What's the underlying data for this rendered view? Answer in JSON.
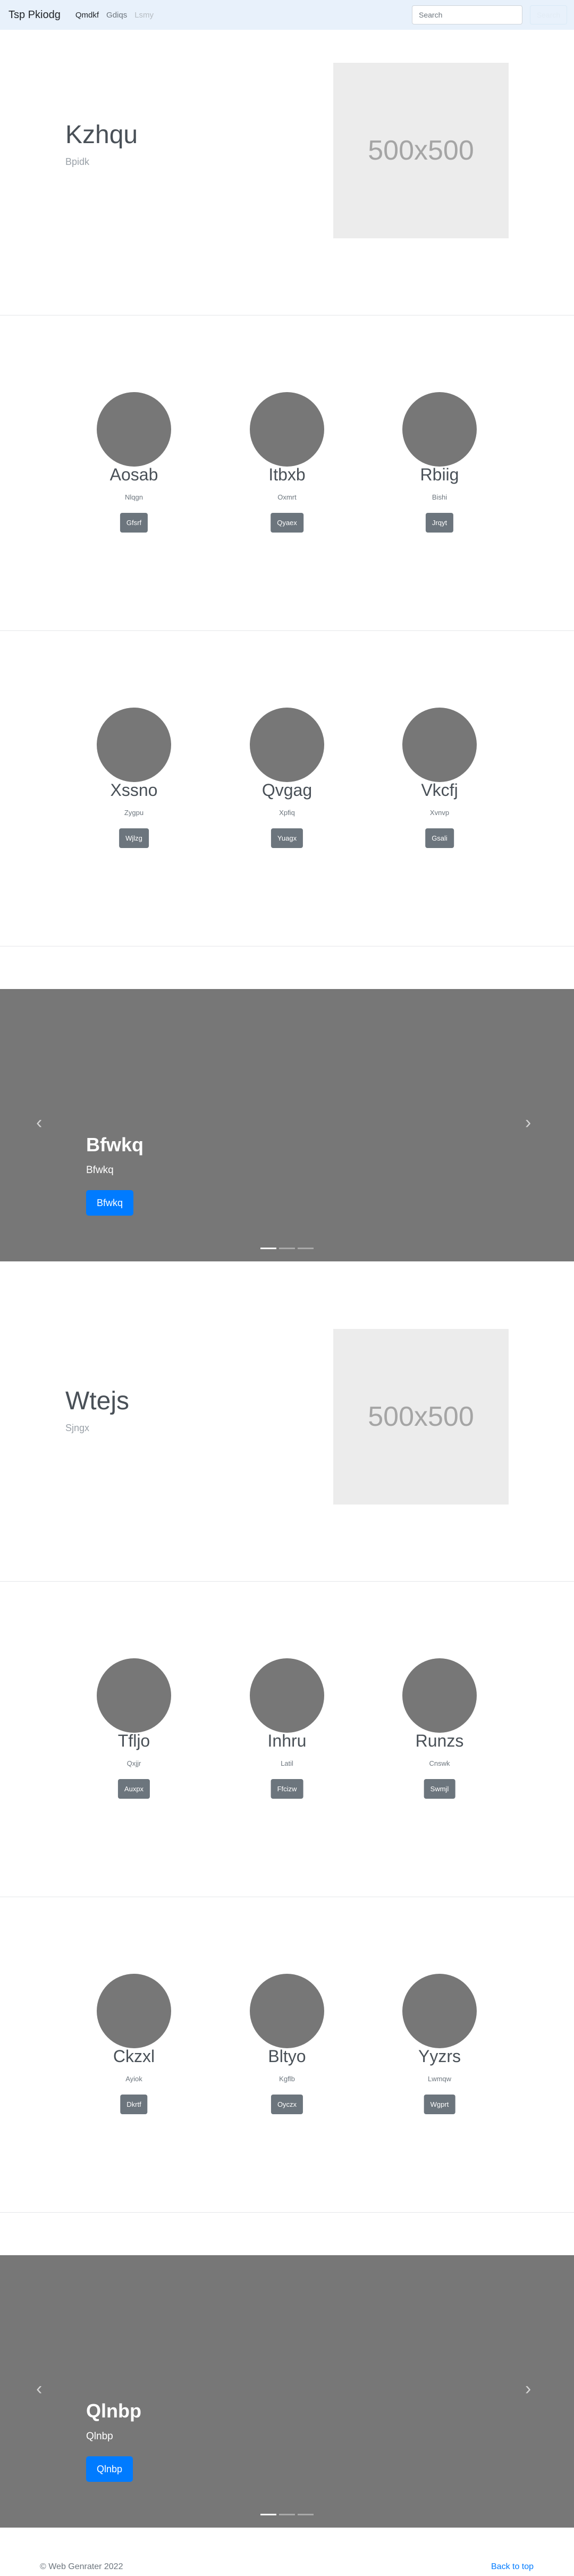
{
  "navbar": {
    "brand": "Tsp Pkiodg",
    "links": [
      "Qmdkf",
      "Gdiqs",
      "Lsmy"
    ],
    "search_placeholder": "Search",
    "search_button": "Search"
  },
  "hero1": {
    "title": "Kzhqu",
    "subtitle": "Bpidk",
    "image_label": "500x500"
  },
  "cards1": [
    {
      "name": "Aosab",
      "sub": "Nlqgn",
      "button": "Gfsrf"
    },
    {
      "name": "Itbxb",
      "sub": "Oxmrt",
      "button": "Qyaex"
    },
    {
      "name": "Rbiig",
      "sub": "Bishi",
      "button": "Jrqyt"
    }
  ],
  "cards2": [
    {
      "name": "Xssno",
      "sub": "Zygpu",
      "button": "Wjlzg"
    },
    {
      "name": "Qvgag",
      "sub": "Xpfiq",
      "button": "Yuagx"
    },
    {
      "name": "Vkcfj",
      "sub": "Xvnvp",
      "button": "Gsali"
    }
  ],
  "carousel1": {
    "title": "Bfwkq",
    "subtitle": "Bfwkq",
    "button": "Bfwkq"
  },
  "hero2": {
    "title": "Wtejs",
    "subtitle": "Sjngx",
    "image_label": "500x500"
  },
  "cards3": [
    {
      "name": "Tfljo",
      "sub": "Qxjjr",
      "button": "Auxpx"
    },
    {
      "name": "Inhru",
      "sub": "Latil",
      "button": "Ffcizw"
    },
    {
      "name": "Runzs",
      "sub": "Cnswk",
      "button": "Swmjl"
    }
  ],
  "cards4": [
    {
      "name": "Ckzxl",
      "sub": "Ayiok",
      "button": "Dkrtf"
    },
    {
      "name": "Bltyo",
      "sub": "Kgflb",
      "button": "Oyczx"
    },
    {
      "name": "Yyzrs",
      "sub": "Lwmqw",
      "button": "Wgprt"
    }
  ],
  "carousel2": {
    "title": "Qlnbp",
    "subtitle": "Qlnbp",
    "button": "Qlnbp"
  },
  "footer": {
    "copyright": "© Web Genrater 2022",
    "back_to_top": "Back to top"
  }
}
